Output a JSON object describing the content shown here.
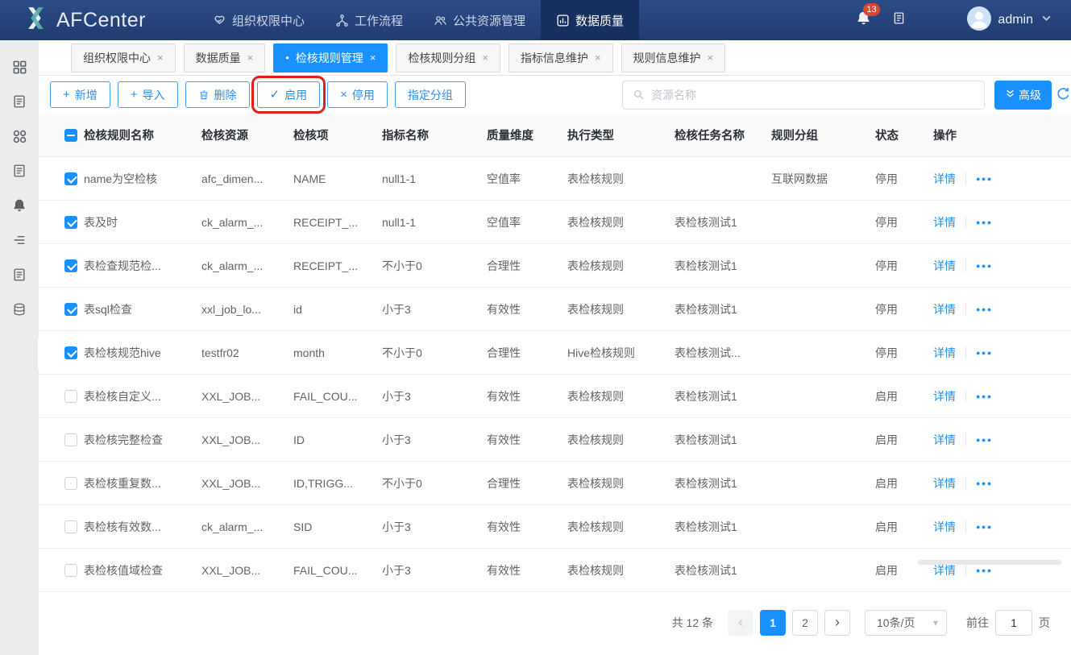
{
  "navbar": {
    "brand": "AFCenter",
    "brand_logo_icon": "afcenter-logo-icon",
    "menu": [
      {
        "label": "组织权限中心",
        "icon": "shield-icon",
        "active": false
      },
      {
        "label": "工作流程",
        "icon": "workflow-icon",
        "active": false
      },
      {
        "label": "公共资源管理",
        "icon": "users-icon",
        "active": false
      },
      {
        "label": "数据质量",
        "icon": "chart-icon",
        "active": true
      }
    ],
    "notification": {
      "icon": "bell-icon",
      "badge": "13"
    },
    "memo_icon": "document-icon",
    "user": {
      "avatar_icon": "avatar-icon",
      "name": "admin",
      "caret_icon": "chevron-down-icon"
    }
  },
  "tabbar": {
    "active_dot": "•",
    "close_icon": "×",
    "tabs": [
      {
        "label": "组织权限中心",
        "active": false
      },
      {
        "label": "数据质量",
        "active": false
      },
      {
        "label": "检核规则管理",
        "active": true
      },
      {
        "label": "检核规则分组",
        "active": false
      },
      {
        "label": "指标信息维护",
        "active": false
      },
      {
        "label": "规则信息维护",
        "active": false
      }
    ]
  },
  "toolbar": {
    "buttons": [
      {
        "label": "新增",
        "icon": "plus-icon",
        "highlighted": false
      },
      {
        "label": "导入",
        "icon": "plus-icon",
        "highlighted": false
      },
      {
        "label": "删除",
        "icon": "trash-icon",
        "highlighted": false
      },
      {
        "label": "启用",
        "icon": "check-icon",
        "highlighted": true
      },
      {
        "label": "停用",
        "icon": "close-icon",
        "highlighted": false
      },
      {
        "label": "指定分组",
        "icon": null,
        "highlighted": false
      }
    ],
    "search": {
      "placeholder": "资源名称",
      "icon": "search-icon"
    },
    "advanced": {
      "label": "高级",
      "icon": "double-chevron-down-icon"
    },
    "refresh_icon": "refresh-icon"
  },
  "table": {
    "columns": [
      "检核规则名称",
      "检核资源",
      "检核项",
      "指标名称",
      "质量维度",
      "执行类型",
      "检核任务名称",
      "规则分组",
      "状态",
      "操作"
    ],
    "header_checkbox_state": "indeterminate",
    "detail_label": "详情",
    "more_icon": "●●●",
    "rows": [
      {
        "checked": true,
        "name": "name为空检核",
        "resource": "afc_dimen...",
        "item": "NAME",
        "indicator": "null1-1",
        "dimension": "空值率",
        "exec_type": "表检核规则",
        "task": "",
        "group": "互联网数据",
        "status": "停用"
      },
      {
        "checked": true,
        "name": "表及时",
        "resource": "ck_alarm_...",
        "item": "RECEIPT_...",
        "indicator": "null1-1",
        "dimension": "空值率",
        "exec_type": "表检核规则",
        "task": "表检核测试1",
        "group": "",
        "status": "停用"
      },
      {
        "checked": true,
        "name": "表检查规范检...",
        "resource": "ck_alarm_...",
        "item": "RECEIPT_...",
        "indicator": "不小于0",
        "dimension": "合理性",
        "exec_type": "表检核规则",
        "task": "表检核测试1",
        "group": "",
        "status": "停用"
      },
      {
        "checked": true,
        "name": "表sql检查",
        "resource": "xxl_job_lo...",
        "item": "id",
        "indicator": "小于3",
        "dimension": "有效性",
        "exec_type": "表检核规则",
        "task": "表检核测试1",
        "group": "",
        "status": "停用"
      },
      {
        "checked": true,
        "name": "表检核规范hive",
        "resource": "testfr02",
        "item": "month",
        "indicator": "不小于0",
        "dimension": "合理性",
        "exec_type": "Hive检核规则",
        "task": "表检核测试...",
        "group": "",
        "status": "停用"
      },
      {
        "checked": false,
        "name": "表检核自定义...",
        "resource": "XXL_JOB...",
        "item": "FAIL_COU...",
        "indicator": "小于3",
        "dimension": "有效性",
        "exec_type": "表检核规则",
        "task": "表检核测试1",
        "group": "",
        "status": "启用"
      },
      {
        "checked": false,
        "name": "表检核完整检查",
        "resource": "XXL_JOB...",
        "item": "ID",
        "indicator": "小于3",
        "dimension": "有效性",
        "exec_type": "表检核规则",
        "task": "表检核测试1",
        "group": "",
        "status": "启用"
      },
      {
        "checked": false,
        "name": "表检核重复数...",
        "resource": "XXL_JOB...",
        "item": "ID,TRIGG...",
        "indicator": "不小于0",
        "dimension": "合理性",
        "exec_type": "表检核规则",
        "task": "表检核测试1",
        "group": "",
        "status": "启用"
      },
      {
        "checked": false,
        "name": "表检核有效数...",
        "resource": "ck_alarm_...",
        "item": "SID",
        "indicator": "小于3",
        "dimension": "有效性",
        "exec_type": "表检核规则",
        "task": "表检核测试1",
        "group": "",
        "status": "启用"
      },
      {
        "checked": false,
        "name": "表检核值域检查",
        "resource": "XXL_JOB...",
        "item": "FAIL_COU...",
        "indicator": "小于3",
        "dimension": "有效性",
        "exec_type": "表检核规则",
        "task": "表检核测试1",
        "group": "",
        "status": "启用"
      }
    ]
  },
  "sidebar": {
    "icons": [
      "apps-grid-icon",
      "document-icon",
      "circles-grid-icon",
      "document-icon",
      "bell-filled-icon",
      "indent-list-icon",
      "document-icon",
      "database-icon"
    ],
    "collapse_icon": "chevron-right-icon"
  },
  "pagination": {
    "total": "共 12 条",
    "prev_icon": "‹",
    "next_icon": "›",
    "pages": [
      "1",
      "2"
    ],
    "active_page": "1",
    "page_size": "10条/页",
    "goto_label": "前往",
    "goto_value": "1",
    "goto_suffix": "页"
  },
  "colors": {
    "accent": "#1890ff",
    "navbar_top": "#2c4d87",
    "navbar_bottom": "#203c70",
    "badge_red": "#e2432e",
    "annotation_red": "#e0201d",
    "sidebar_bg": "#ededee"
  }
}
